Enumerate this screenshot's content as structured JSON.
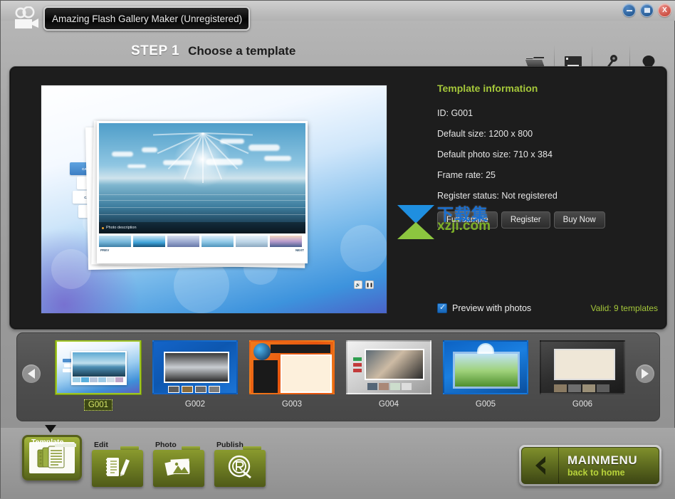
{
  "window": {
    "app_title": "Amazing Flash Gallery Maker (Unregistered)",
    "app_icon": "video-camera-icon",
    "minimize_label": "–",
    "maximize_label": "□",
    "close_label": "X"
  },
  "header": {
    "step_number": "STEP 1",
    "step_title": "Choose a template",
    "toolbar": [
      {
        "label": "File",
        "icon": "folder-icon"
      },
      {
        "label": "Save",
        "icon": "floppy-disk-icon"
      },
      {
        "label": "Register",
        "icon": "key-icon"
      },
      {
        "label": "Help",
        "icon": "lightbulb-icon"
      }
    ]
  },
  "preview": {
    "nav_items": [
      "CATEGORY1",
      "CATEGORY2",
      "CATEGORY3",
      "ABOUT US"
    ],
    "photo_description": "Photo description",
    "prev_label": "PREV",
    "next_label": "NEXT",
    "sound_icon": "speaker-icon",
    "pause_icon": "pause-icon"
  },
  "info": {
    "heading": "Template information",
    "id": "ID: G001",
    "default_size": "Default size: 1200 x 800",
    "default_photo_size": "Default photo size: 710 x 384",
    "frame_rate": "Frame rate: 25",
    "register_status": "Register status: Not registered",
    "buttons": [
      "Full sample",
      "Register",
      "Buy Now"
    ],
    "checkbox_label": "Preview with photos",
    "checkbox_checked": true,
    "valid_text": "Valid: 9 templates",
    "accent_green": "#a5c73a"
  },
  "watermark": {
    "cn": "下载集",
    "en": "xzji.com"
  },
  "templates": {
    "prev_icon": "chevron-left-icon",
    "next_icon": "chevron-right-icon",
    "items": [
      {
        "name": "G001",
        "selected": true
      },
      {
        "name": "G002",
        "selected": false
      },
      {
        "name": "G003",
        "selected": false
      },
      {
        "name": "G004",
        "selected": false
      },
      {
        "name": "G005",
        "selected": false
      },
      {
        "name": "G006",
        "selected": false
      }
    ]
  },
  "bottom_tabs": [
    {
      "label": "Template",
      "icon": "documents-icon",
      "active": true
    },
    {
      "label": "Edit",
      "icon": "notebook-pencil-icon",
      "active": false
    },
    {
      "label": "Photo",
      "icon": "photos-icon",
      "active": false
    },
    {
      "label": "Publish",
      "icon": "publish-target-icon",
      "active": false
    }
  ],
  "mainmenu": {
    "title": "MAINMENU",
    "subtitle": "back to home",
    "icon": "back-arrow-icon"
  }
}
